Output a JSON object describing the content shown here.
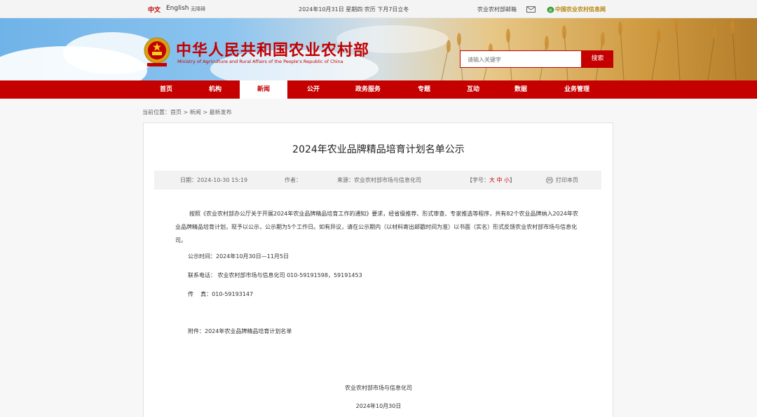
{
  "topbar": {
    "lang_zh": "中文",
    "lang_en": "English",
    "lang_accessible": "无障碍",
    "date": "2024年10月31日 星期四 农历 下月7日立冬",
    "mailbox": "农业农村部邮箱",
    "info_net": "中国农业农村信息网"
  },
  "banner": {
    "title": "中华人民共和国农业农村部",
    "subtitle": "Ministry of Agriculture and Rural Affairs of the People's Republic of China",
    "search_placeholder": "请输入关键字",
    "search_button": "搜索"
  },
  "nav": {
    "items": [
      {
        "label": "首页"
      },
      {
        "label": "机构"
      },
      {
        "label": "新闻"
      },
      {
        "label": "公开"
      },
      {
        "label": "政务服务"
      },
      {
        "label": "专题"
      },
      {
        "label": "互动"
      },
      {
        "label": "数据"
      },
      {
        "label": "业务管理"
      }
    ],
    "active": "新闻"
  },
  "breadcrumb": "当前位置：首页 > 新闻 > 最新发布",
  "article": {
    "title": "2024年农业品牌精品培育计划名单公示",
    "meta": {
      "date": "日期：2024-10-30 15:19",
      "author": "作者：",
      "source": "来源：农业农村部市场与信息化司",
      "font_prefix": "【字号：",
      "font_large": "大",
      "font_medium": "中",
      "font_small": "小",
      "font_suffix": "】",
      "print": "打印本页"
    },
    "body": "按照《农业农村部办公厅关于开展2024年农业品牌精品培育工作的通知》要求，经省级推荐、形式审查、专家推选等程序，共有82个农业品牌纳入2024年农业品牌精品培育计划，现予以公示，公示期为5个工作日。如有异议，请在公示期内（以材料寄出邮戳时间为准）以书面（实名）形式反馈农业农村部市场与信息化司。",
    "notice_time": "公示时间：2024年10月30日—11月5日",
    "phone": "联系电话：  农业农村部市场与信息化司  010-59191598，59191453",
    "fax": "传    真：010-59193147",
    "attachment": "附件：2024年农业品牌精品培育计划名单",
    "signature": "农业农村部市场与信息化司",
    "sign_date": "2024年10月30日"
  },
  "colors": {
    "brand_red": "#c40000",
    "nav_bg": "#c40000"
  }
}
